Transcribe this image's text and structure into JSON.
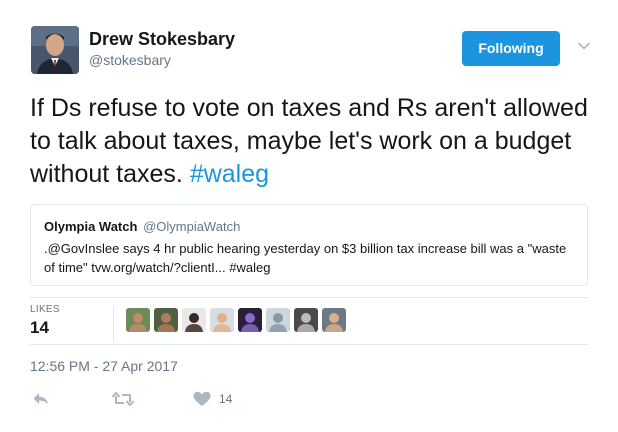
{
  "tweet": {
    "author": {
      "name": "Drew Stokesbary",
      "handle": "@stokesbary"
    },
    "follow_button_label": "Following",
    "text_plain": "If Ds refuse to vote on taxes and Rs aren't allowed to talk about taxes, maybe let's work on a budget without taxes. ",
    "hashtag": "#waleg",
    "quoted": {
      "name": "Olympia Watch",
      "handle": "@OlympiaWatch",
      "text": ".@GovInslee says 4 hr public hearing yesterday on $3 billion tax increase bill was a \"waste of time\" tvw.org/watch/?clientI... #waleg"
    },
    "likes": {
      "label": "LIKES",
      "count": "14"
    },
    "likers": [
      {
        "id": "liker-1",
        "bg": "#6f8a5a",
        "fg": "#c48a6a"
      },
      {
        "id": "liker-2",
        "bg": "#506040",
        "fg": "#b07a5c"
      },
      {
        "id": "liker-3",
        "bg": "#e8e8e8",
        "fg": "#3a2a22"
      },
      {
        "id": "liker-4",
        "bg": "#d8dde2",
        "fg": "#e0b090"
      },
      {
        "id": "liker-5",
        "bg": "#2a1f3a",
        "fg": "#8a6ac8"
      },
      {
        "id": "liker-6",
        "bg": "#ccd6dd",
        "fg": "#8899a6"
      },
      {
        "id": "liker-7",
        "bg": "#4a4a4a",
        "fg": "#bbbbbb"
      },
      {
        "id": "liker-8",
        "bg": "#6d7a86",
        "fg": "#d8b08c"
      }
    ],
    "timestamp": "12:56 PM - 27 Apr 2017",
    "actions": {
      "like_count": "14"
    }
  },
  "colors": {
    "accent": "#1b95e0",
    "text": "#14171a",
    "muted": "#657786",
    "border": "#e1e8ed",
    "action_icon": "#aab8c2"
  },
  "icons": {
    "reply": "reply-icon",
    "retweet": "retweet-icon",
    "like": "heart-icon",
    "more": "chevron-down-icon"
  }
}
